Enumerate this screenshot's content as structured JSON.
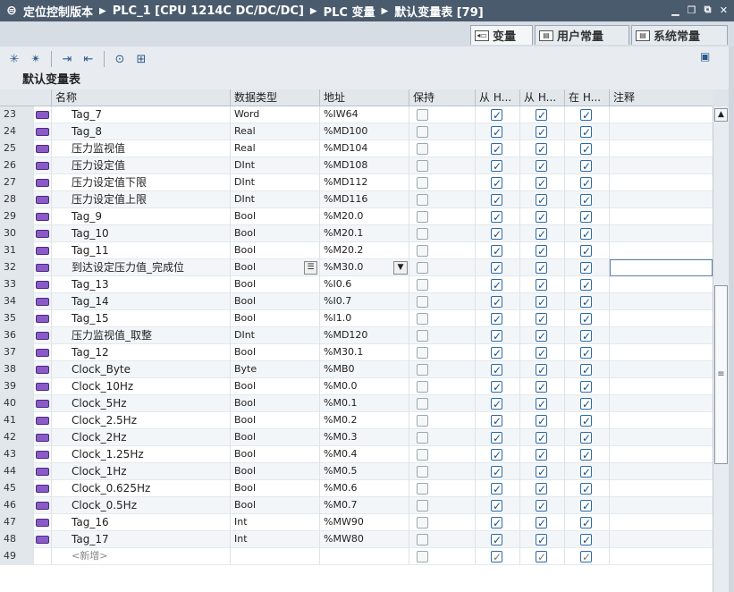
{
  "titlebar": {
    "crumbs": [
      "定位控制版本",
      "PLC_1 [CPU 1214C DC/DC/DC]",
      "PLC 变量",
      "默认变量表 [79]"
    ]
  },
  "tabs": [
    {
      "label": "变量",
      "active": true
    },
    {
      "label": "用户常量",
      "active": false
    },
    {
      "label": "系统常量",
      "active": false
    }
  ],
  "section_title": "默认变量表",
  "columns": {
    "name": "名称",
    "datatype": "数据类型",
    "address": "地址",
    "retain": "保持",
    "from_hmi": "从 H...",
    "from_hmi2": "从 H...",
    "in_hmi": "在 H...",
    "comment": "注释"
  },
  "rows": [
    {
      "num": "23",
      "name": "Tag_7",
      "type": "Word",
      "addr": "%IW64"
    },
    {
      "num": "24",
      "name": "Tag_8",
      "type": "Real",
      "addr": "%MD100"
    },
    {
      "num": "25",
      "name": "压力监视值",
      "type": "Real",
      "addr": "%MD104"
    },
    {
      "num": "26",
      "name": "压力设定值",
      "type": "DInt",
      "addr": "%MD108"
    },
    {
      "num": "27",
      "name": "压力设定值下限",
      "type": "DInt",
      "addr": "%MD112"
    },
    {
      "num": "28",
      "name": "压力设定值上限",
      "type": "DInt",
      "addr": "%MD116"
    },
    {
      "num": "29",
      "name": "Tag_9",
      "type": "Bool",
      "addr": "%M20.0"
    },
    {
      "num": "30",
      "name": "Tag_10",
      "type": "Bool",
      "addr": "%M20.1"
    },
    {
      "num": "31",
      "name": "Tag_11",
      "type": "Bool",
      "addr": "%M20.2"
    },
    {
      "num": "32",
      "name": "到达设定压力值_完成位",
      "type": "Bool",
      "addr": "%M30.0"
    },
    {
      "num": "33",
      "name": "Tag_13",
      "type": "Bool",
      "addr": "%I0.6"
    },
    {
      "num": "34",
      "name": "Tag_14",
      "type": "Bool",
      "addr": "%I0.7"
    },
    {
      "num": "35",
      "name": "Tag_15",
      "type": "Bool",
      "addr": "%I1.0"
    },
    {
      "num": "36",
      "name": "压力监视值_取整",
      "type": "DInt",
      "addr": "%MD120"
    },
    {
      "num": "37",
      "name": "Tag_12",
      "type": "Bool",
      "addr": "%M30.1"
    },
    {
      "num": "38",
      "name": "Clock_Byte",
      "type": "Byte",
      "addr": "%MB0"
    },
    {
      "num": "39",
      "name": "Clock_10Hz",
      "type": "Bool",
      "addr": "%M0.0"
    },
    {
      "num": "40",
      "name": "Clock_5Hz",
      "type": "Bool",
      "addr": "%M0.1"
    },
    {
      "num": "41",
      "name": "Clock_2.5Hz",
      "type": "Bool",
      "addr": "%M0.2"
    },
    {
      "num": "42",
      "name": "Clock_2Hz",
      "type": "Bool",
      "addr": "%M0.3"
    },
    {
      "num": "43",
      "name": "Clock_1.25Hz",
      "type": "Bool",
      "addr": "%M0.4"
    },
    {
      "num": "44",
      "name": "Clock_1Hz",
      "type": "Bool",
      "addr": "%M0.5"
    },
    {
      "num": "45",
      "name": "Clock_0.625Hz",
      "type": "Bool",
      "addr": "%M0.6"
    },
    {
      "num": "46",
      "name": "Clock_0.5Hz",
      "type": "Bool",
      "addr": "%M0.7"
    },
    {
      "num": "47",
      "name": "Tag_16",
      "type": "Int",
      "addr": "%MW90"
    },
    {
      "num": "48",
      "name": "Tag_17",
      "type": "Int",
      "addr": "%MW80"
    }
  ],
  "new_row": {
    "num": "49",
    "name": "<新增>"
  },
  "selected_row": "32"
}
